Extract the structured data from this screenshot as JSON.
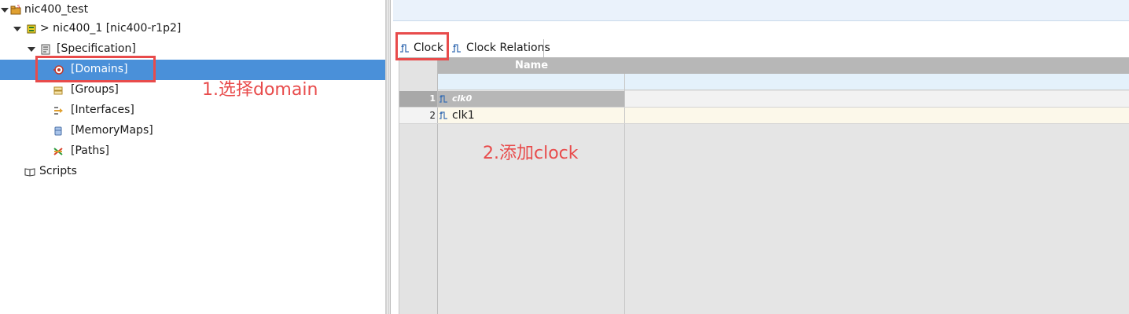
{
  "tree": {
    "root": {
      "label": "nic400_test",
      "icon": "project-folder-icon"
    },
    "instance": {
      "label": "> nic400_1 [nic400-r1p2]",
      "icon": "component-icon"
    },
    "specification": {
      "label": "[Specification]",
      "icon": "document-icon"
    },
    "items": [
      {
        "label": "[Domains]",
        "icon": "domains-icon",
        "selected": true
      },
      {
        "label": "[Groups]",
        "icon": "groups-icon",
        "selected": false
      },
      {
        "label": "[Interfaces]",
        "icon": "interfaces-icon",
        "selected": false
      },
      {
        "label": "[MemoryMaps]",
        "icon": "memorymaps-icon",
        "selected": false
      },
      {
        "label": "[Paths]",
        "icon": "paths-icon",
        "selected": false
      }
    ],
    "scripts": {
      "label": "Scripts",
      "icon": "book-icon"
    }
  },
  "tabs": [
    {
      "label": "Clock",
      "icon": "clock-signal-icon",
      "active": true
    },
    {
      "label": "Clock Relations",
      "icon": "clock-signal-icon",
      "active": false
    }
  ],
  "grid": {
    "columns": [
      "Name"
    ],
    "rows": [
      {
        "num": "1",
        "name": "clk0",
        "selected": true
      },
      {
        "num": "2",
        "name": "clk1",
        "selected": false
      }
    ]
  },
  "annotations": {
    "step1": "1.选择domain",
    "step2": "2.添加clock"
  },
  "colors": {
    "selection": "#4a90d9",
    "annotation": "#e84b4b",
    "header": "#b7b7b7"
  }
}
